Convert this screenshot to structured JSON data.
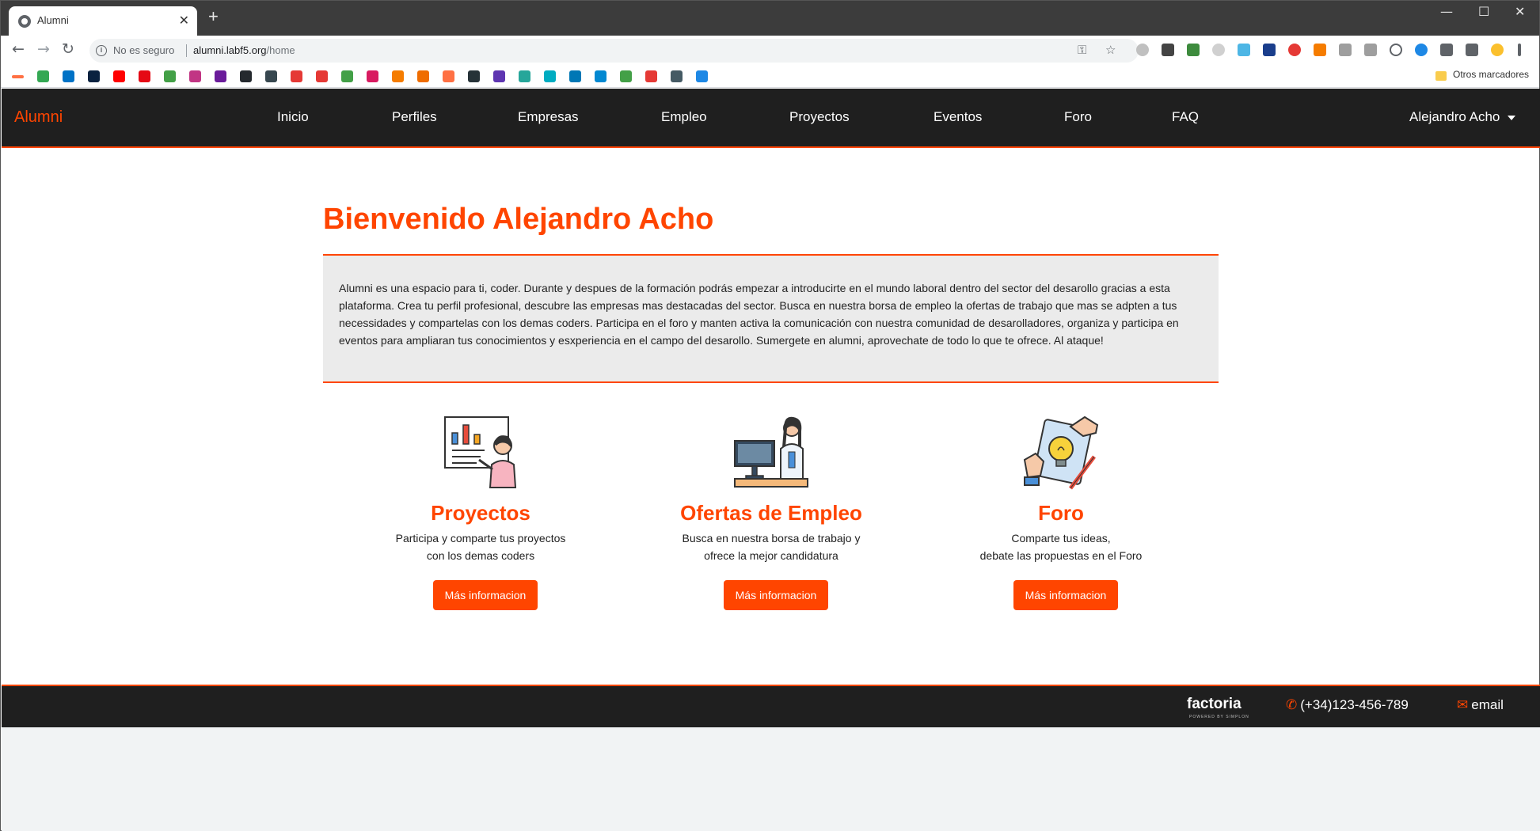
{
  "browser": {
    "tab_title": "Alumni",
    "tab_close": "✕",
    "new_tab": "+",
    "window_controls": [
      "—",
      "☐",
      "✕"
    ],
    "nav": {
      "back": "←",
      "forward": "→",
      "reload": "↻"
    },
    "security_label": "No es seguro",
    "url_host": "alumni.labf5.org",
    "url_path": "/home",
    "other_bookmarks": "Otros marcadores"
  },
  "site": {
    "brand": "Alumni",
    "nav": [
      "Inicio",
      "Perfiles",
      "Empresas",
      "Empleo",
      "Proyectos",
      "Eventos",
      "Foro",
      "FAQ"
    ],
    "user": "Alejandro Acho",
    "welcome": "Bienvenido Alejandro Acho",
    "intro": "Alumni es una espacio para ti, coder. Durante y despues de la formación podrás empezar a introducirte en el mundo laboral dentro del sector del desarollo gracias a esta plataforma. Crea tu perfil profesional, descubre las empresas mas destacadas del sector. Busca en nuestra borsa de empleo la ofertas de trabajo que mas se adpten a tus necessidades y compartelas con los demas coders. Participa en el foro y manten activa la comunicación con nuestra comunidad de desarolladores, organiza y participa en eventos para ampliaran tus conocimientos y esxperiencia en el campo del desarollo. Sumergete en alumni, aprovechate de todo lo que te ofrece. Al ataque!",
    "cards": [
      {
        "title": "Proyectos",
        "line1": "Participa y comparte tus proyectos",
        "line2": "con los demas coders",
        "button": "Más informacion",
        "icon": "presentation-icon"
      },
      {
        "title": "Ofertas de Empleo",
        "line1": "Busca en nuestra borsa de trabajo y",
        "line2": "ofrece la mejor candidatura",
        "button": "Más informacion",
        "icon": "workstation-icon"
      },
      {
        "title": "Foro",
        "line1": "Comparte tus ideas,",
        "line2": "debate las propuestas en el Foro",
        "button": "Más informacion",
        "icon": "idea-icon"
      }
    ],
    "footer": {
      "logo": "factoria",
      "logo_sub": "POWERED BY SIMPLON",
      "phone": "(+34)123-456-789",
      "email": "email"
    }
  },
  "colors": {
    "accent": "#ff4500",
    "nav_bg": "#1f1f1f",
    "intro_bg": "#ebebeb"
  }
}
